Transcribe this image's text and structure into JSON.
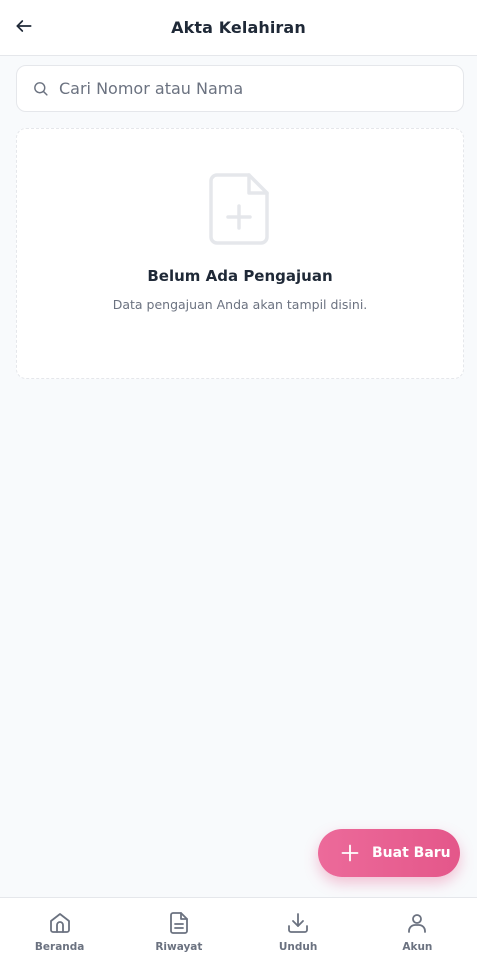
{
  "header": {
    "title": "Akta Kelahiran",
    "back_icon": "arrow-left-icon"
  },
  "search": {
    "placeholder": "Cari Nomor atau Nama",
    "value": "",
    "icon": "search-icon"
  },
  "empty_state": {
    "icon": "file-plus-icon",
    "title": "Belum Ada Pengajuan",
    "description": "Data pengajuan Anda akan tampil disini."
  },
  "fab": {
    "label": "Buat Baru",
    "icon": "plus-icon"
  },
  "bottom_nav": {
    "items": [
      {
        "label": "Beranda",
        "icon": "home-icon"
      },
      {
        "label": "Riwayat",
        "icon": "document-icon"
      },
      {
        "label": "Unduh",
        "icon": "download-icon"
      },
      {
        "label": "Akun",
        "icon": "user-icon"
      }
    ]
  },
  "colors": {
    "accent": "#e4578a",
    "text_primary": "#1f2937",
    "text_muted": "#6b7280",
    "border": "#e5e7eb",
    "background": "#f8fafc"
  }
}
